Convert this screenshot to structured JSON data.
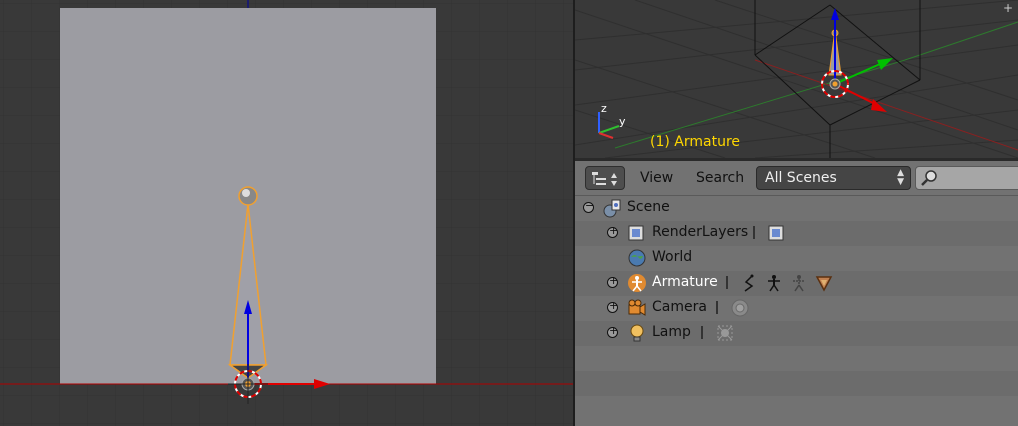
{
  "viewport3d": {
    "active_object_label": "(1) Armature"
  },
  "outliner": {
    "header": {
      "view_label": "View",
      "search_label": "Search",
      "display_mode": "All Scenes",
      "search_placeholder": ""
    },
    "tree": [
      {
        "label": "Scene",
        "depth": 0,
        "expanded": true
      },
      {
        "label": "RenderLayers",
        "depth": 1,
        "expanded": false
      },
      {
        "label": "World",
        "depth": 1,
        "expanded": false
      },
      {
        "label": "Armature",
        "depth": 1,
        "expanded": false,
        "selected": true
      },
      {
        "label": "Camera",
        "depth": 1,
        "expanded": false
      },
      {
        "label": "Lamp",
        "depth": 1,
        "expanded": false
      }
    ]
  },
  "colors": {
    "accent_selected": "#f0a030",
    "object_label": "#ffd700",
    "x_axis": "#e00000",
    "y_axis": "#00c000",
    "z_axis": "#0000e0"
  }
}
